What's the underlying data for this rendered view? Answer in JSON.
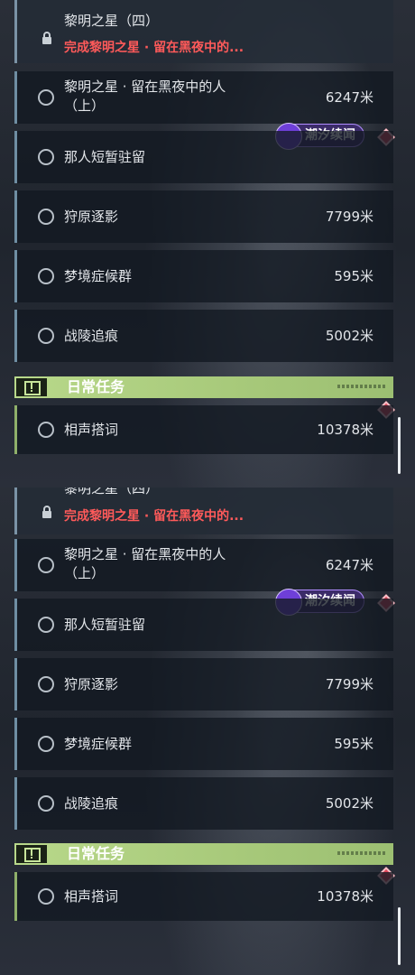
{
  "quest_list": {
    "locked_quest": {
      "title": "黎明之星（四）",
      "requirement": "完成黎明之星 · 留在黑夜中的..."
    },
    "quests": [
      {
        "title_line1": "黎明之星 · 留在黑夜中的人",
        "title_line2": "（上）",
        "distance": "6247米"
      },
      {
        "title_line1": "那人短暂驻留",
        "distance": ""
      },
      {
        "title_line1": "狩原逐影",
        "distance": "7799米"
      },
      {
        "title_line1": "梦境症候群",
        "distance": "595米"
      },
      {
        "title_line1": "战陵追痕",
        "distance": "5002米"
      }
    ],
    "event_badge": {
      "label": "潮汐续闻",
      "color": "#b08cff"
    },
    "daily_section": {
      "label": "日常任务",
      "accent_color": "#a7c97a",
      "quests": [
        {
          "title_line1": "相声搭词",
          "distance": "10378米"
        }
      ]
    },
    "alert_marker_color": "#e0475a",
    "icons": {
      "locked": "lock-icon",
      "quest_status": "radio-circle-icon",
      "daily": "alert-square-icon",
      "event": "lightning-emblem-icon",
      "marker": "red-diamond-icon"
    }
  }
}
